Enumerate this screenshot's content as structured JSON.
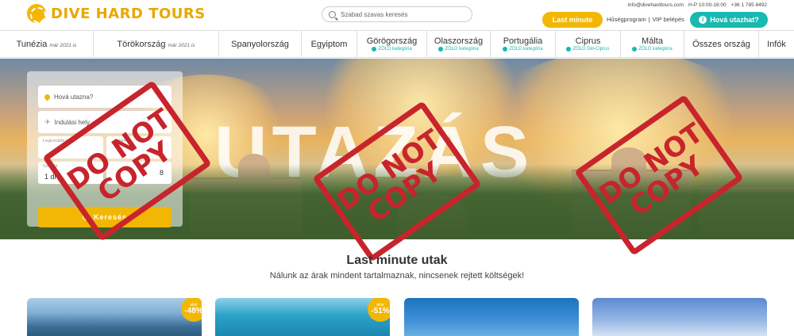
{
  "header": {
    "logo_text": "DIVE HARD TOURS",
    "logo_badge": "DHT",
    "search_placeholder": "Szabad szavas keresés",
    "last_minute_label": "Last minute",
    "loyalty_label": "Hűségprogram",
    "separator": "|",
    "vip_label": "VIP belépés",
    "where_label": "Hová utazhat?",
    "email": "info@divehardtours.com",
    "hours": "H-P 10:00-16:00",
    "phone": "+36 1 785 8492"
  },
  "nav": {
    "items": [
      {
        "label": "Tunézia",
        "note": "már 2021 is",
        "badge": ""
      },
      {
        "label": "Törökország",
        "note": "már 2021 is",
        "badge": ""
      },
      {
        "label": "Spanyolország",
        "note": "",
        "badge": ""
      },
      {
        "label": "Egyiptom",
        "note": "",
        "badge": ""
      },
      {
        "label": "Görögország",
        "note": "",
        "badge": "ZÖLD kategória"
      },
      {
        "label": "Olaszország",
        "note": "",
        "badge": "ZÖLD kategória"
      },
      {
        "label": "Portugália",
        "note": "",
        "badge": "ZÖLD kategória"
      },
      {
        "label": "Ciprus",
        "note": "",
        "badge": "ZÖLD Dél-Ciprus"
      },
      {
        "label": "Málta",
        "note": "",
        "badge": "ZÖLD kategória"
      },
      {
        "label": "Összes ország",
        "note": "",
        "badge": ""
      },
      {
        "label": "Infók",
        "note": "",
        "badge": ""
      }
    ]
  },
  "hero": {
    "big_text": "UTAZÁS",
    "destination_placeholder": "Hová utazna?",
    "departure_placeholder": "Indulási hely",
    "earliest_label": "Legkorábbi ind...",
    "latest_label": "...artam",
    "duration_label": "Szobák",
    "duration_value": "1 dl",
    "guests_value": "8",
    "search_button": "Keresés"
  },
  "stamps": [
    {
      "line1": "DO NOT",
      "line2": "COPY"
    },
    {
      "line1": "DO NOT",
      "line2": "COPY"
    },
    {
      "line1": "DO NOT",
      "line2": "COPY"
    }
  ],
  "section": {
    "title": "Last minute utak",
    "subtitle": "Nálunk az árak mindent tartalmaznak, nincsenek rejtett költségek!"
  },
  "cards": [
    {
      "discount_prefix": "akár",
      "discount": "-48%"
    },
    {
      "discount_prefix": "akár",
      "discount": "-51%"
    },
    {
      "discount_prefix": "",
      "discount": ""
    },
    {
      "discount_prefix": "",
      "discount": ""
    }
  ],
  "colors": {
    "brand_yellow": "#f2b705",
    "teal": "#17b9b0",
    "stamp_red": "#c8242c"
  }
}
